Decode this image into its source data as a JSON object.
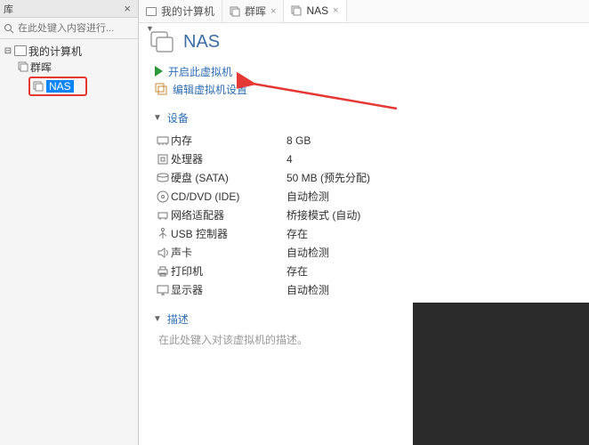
{
  "sidebar": {
    "title": "库",
    "search_placeholder": "在此处键入内容进行...",
    "root": "我的计算机",
    "items": [
      "群晖",
      "NAS"
    ]
  },
  "tabs": [
    {
      "label": "我的计算机",
      "icon": "host"
    },
    {
      "label": "群晖",
      "icon": "stack"
    },
    {
      "label": "NAS",
      "icon": "stack"
    }
  ],
  "vm": {
    "name": "NAS",
    "actions": {
      "power_on": "开启此虚拟机",
      "edit": "编辑虚拟机设置"
    }
  },
  "sections": {
    "devices": "设备",
    "description": "描述"
  },
  "devices": [
    {
      "label": "内存",
      "value": "8 GB",
      "icon": "mem"
    },
    {
      "label": "处理器",
      "value": "4",
      "icon": "cpu"
    },
    {
      "label": "硬盘 (SATA)",
      "value": "50 MB (预先分配)",
      "icon": "disk"
    },
    {
      "label": "CD/DVD (IDE)",
      "value": "自动检测",
      "icon": "cd"
    },
    {
      "label": "网络适配器",
      "value": "桥接模式 (自动)",
      "icon": "net"
    },
    {
      "label": "USB 控制器",
      "value": "存在",
      "icon": "usb"
    },
    {
      "label": "声卡",
      "value": "自动检测",
      "icon": "snd"
    },
    {
      "label": "打印机",
      "value": "存在",
      "icon": "prn"
    },
    {
      "label": "显示器",
      "value": "自动检测",
      "icon": "disp"
    }
  ],
  "description_placeholder": "在此处键入对该虚拟机的描述。"
}
